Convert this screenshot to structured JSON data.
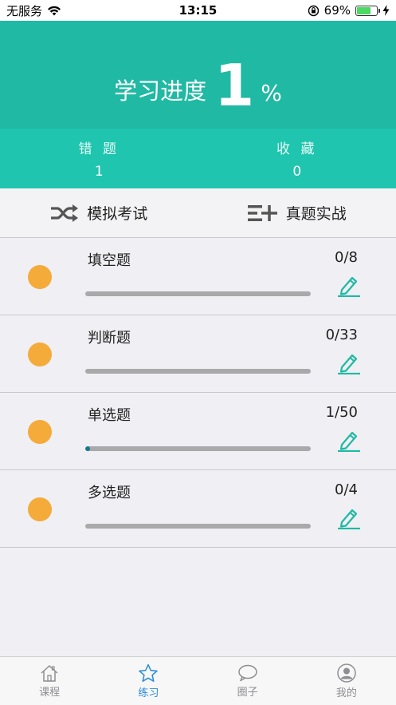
{
  "status_bar": {
    "carrier": "无服务",
    "time": "13:15",
    "battery_percent": "69%",
    "battery_level": 0.69
  },
  "header": {
    "progress_label": "学习进度",
    "progress_value": "1",
    "progress_unit": "%"
  },
  "stats": [
    {
      "label": "错 题",
      "value": "1"
    },
    {
      "label": "收 藏",
      "value": "0"
    }
  ],
  "actions": [
    {
      "label": "模拟考试",
      "icon": "shuffle-icon"
    },
    {
      "label": "真题实战",
      "icon": "list-add-icon"
    }
  ],
  "questions": [
    {
      "title": "填空题",
      "count": "0/8",
      "progress": 0.0
    },
    {
      "title": "判断题",
      "count": "0/33",
      "progress": 0.0
    },
    {
      "title": "单选题",
      "count": "1/50",
      "progress": 0.02
    },
    {
      "title": "多选题",
      "count": "0/4",
      "progress": 0.0
    }
  ],
  "tabs": [
    {
      "label": "课程",
      "icon": "home-icon",
      "active": false
    },
    {
      "label": "练习",
      "icon": "star-icon",
      "active": true
    },
    {
      "label": "圈子",
      "icon": "chat-bubble-icon",
      "active": false
    },
    {
      "label": "我的",
      "icon": "profile-icon",
      "active": false
    }
  ],
  "colors": {
    "header_top": "#20b9a3",
    "header_stats": "#1fc5ae",
    "dot": "#f5ab3a",
    "edit_icon": "#20b9a3",
    "progress_fill": "#137a8a",
    "tab_active": "#2a8bd9"
  }
}
